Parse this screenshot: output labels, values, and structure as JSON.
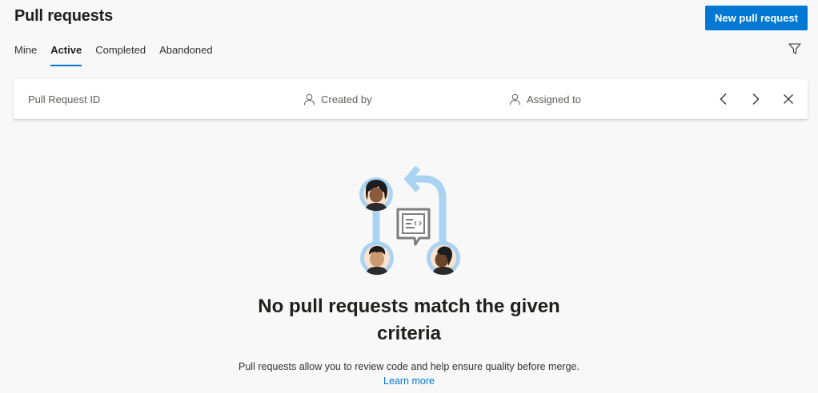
{
  "header": {
    "title": "Pull requests",
    "new_button_label": "New pull request"
  },
  "tabs": [
    {
      "label": "Mine",
      "active": false
    },
    {
      "label": "Active",
      "active": true
    },
    {
      "label": "Completed",
      "active": false
    },
    {
      "label": "Abandoned",
      "active": false
    }
  ],
  "filter_bar": {
    "pr_id_placeholder": "Pull Request ID",
    "created_by_placeholder": "Created by",
    "assigned_to_placeholder": "Assigned to"
  },
  "empty_state": {
    "title_line1": "No pull requests match the given",
    "title_line2": "criteria",
    "description": "Pull requests allow you to review code and help ensure quality before merge.",
    "learn_more": "Learn more"
  },
  "icons": {
    "filter": "filter-funnel-icon",
    "person": "person-icon",
    "prev": "chevron-left-icon",
    "next": "chevron-right-icon",
    "close": "close-icon"
  },
  "colors": {
    "accent": "#0078d4",
    "background": "#f8f8f8",
    "illustration_blue": "#a9d3f2"
  }
}
